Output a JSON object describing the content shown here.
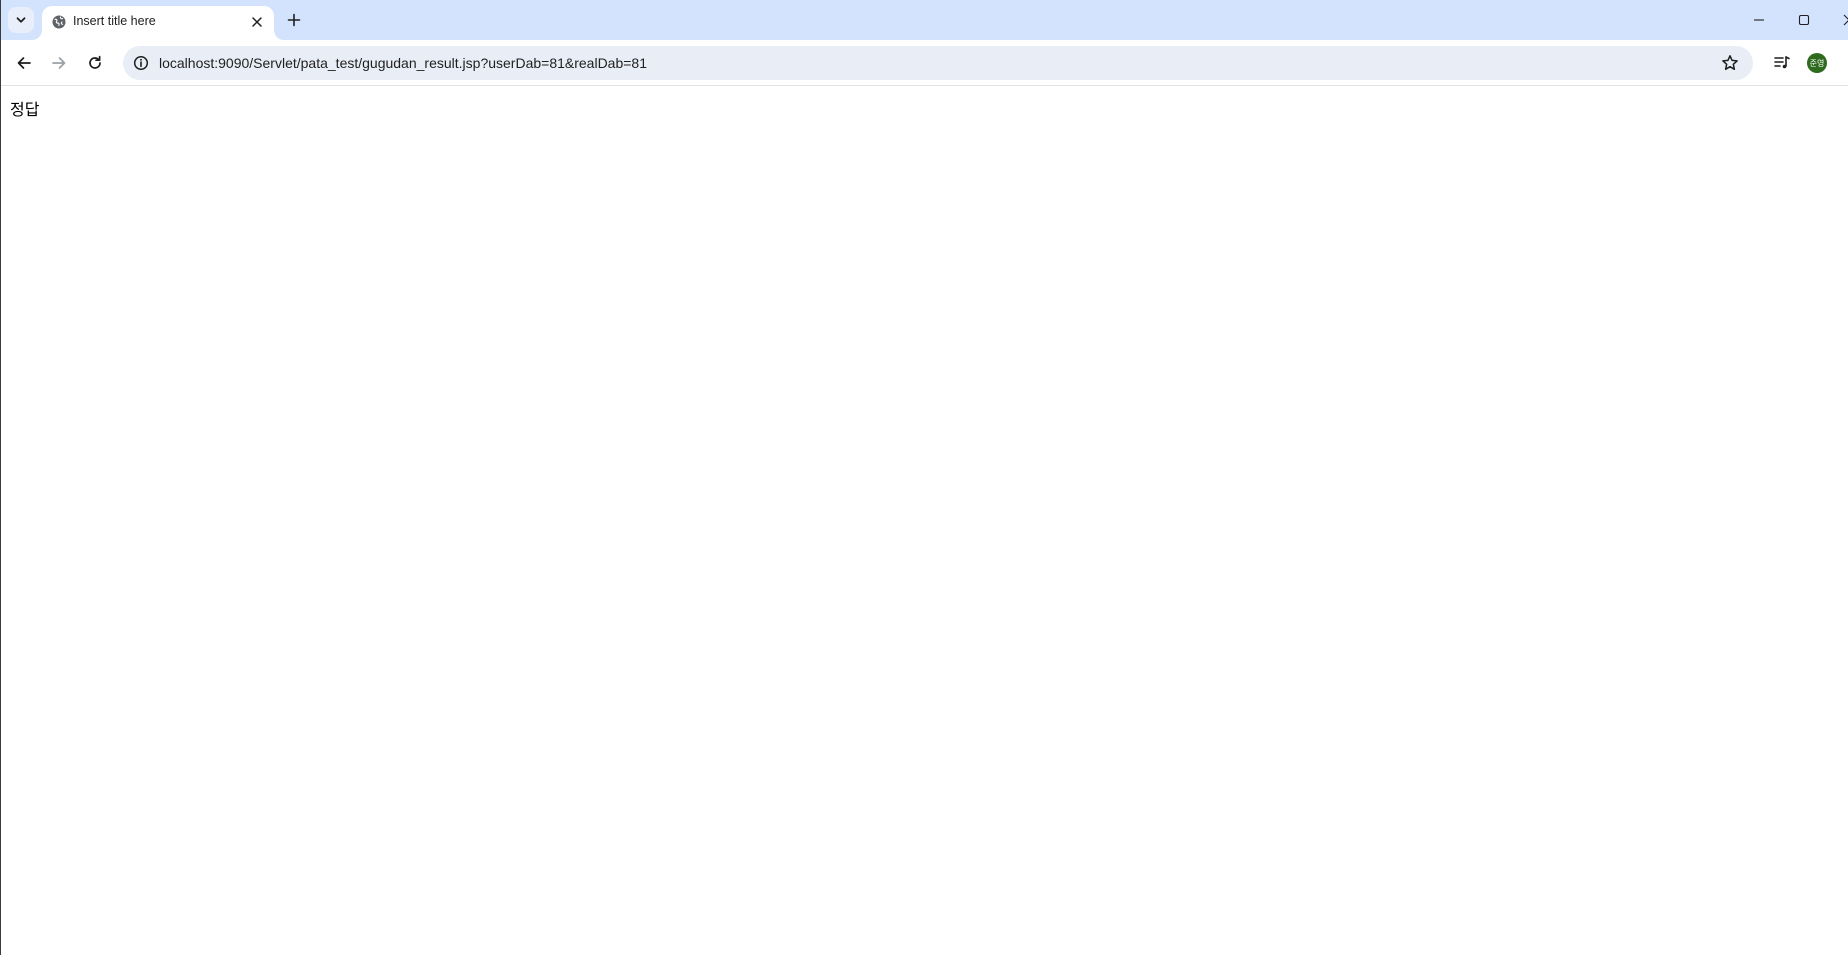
{
  "browser": {
    "tab": {
      "title": "Insert title here",
      "favicon": "globe-icon"
    },
    "address_bar": {
      "url": "localhost:9090/Servlet/pata_test/gugudan_result.jsp?userDab=81&realDab=81"
    },
    "profile": {
      "initials": "준영",
      "color": "#2e6b1f"
    },
    "colors": {
      "tabstrip": "#d3e3fd",
      "omnibox": "#e9eef6"
    }
  },
  "page": {
    "result_text": "정답"
  }
}
